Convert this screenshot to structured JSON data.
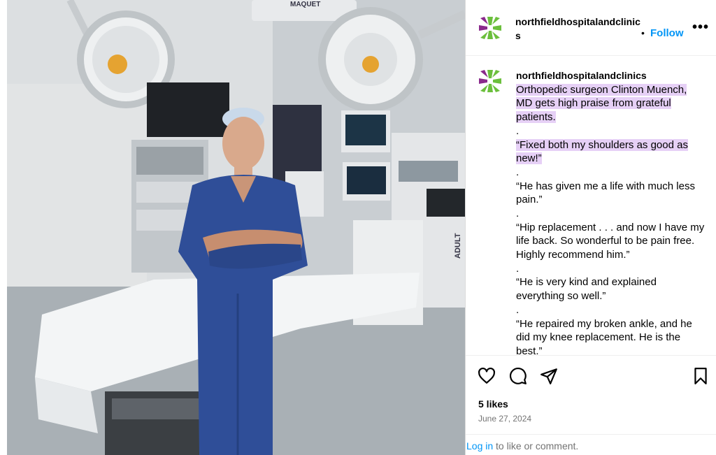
{
  "post": {
    "image_alt": "Surgeon in blue scrubs standing with arms crossed in an operating room",
    "equipment_text": "MAQUET",
    "equipment_side_text": "ADULT"
  },
  "header": {
    "username": "northfieldhospitalandclinics",
    "separator": "•",
    "follow_label": "Follow",
    "more_label": "•••"
  },
  "caption": {
    "username": "northfieldhospitalandclinics",
    "lines": [
      {
        "text": "Orthopedic surgeon Clinton Muench, MD gets high praise from grateful patients.",
        "highlight": true
      },
      {
        "text": ".",
        "highlight": false
      },
      {
        "text": "“Fixed both my shoulders as good as new!”",
        "highlight": true
      },
      {
        "text": ".",
        "highlight": false
      },
      {
        "text": "“He has given me a life with much less pain.”",
        "highlight": false
      },
      {
        "text": ".",
        "highlight": false
      },
      {
        "text": "“Hip replacement . . . and now I have my life back. So wonderful to be pain free. Highly recommend him.”",
        "highlight": false
      },
      {
        "text": ".",
        "highlight": false
      },
      {
        "text": "“He is very kind and explained everything so well.”",
        "highlight": false
      },
      {
        "text": ".",
        "highlight": false
      },
      {
        "text": "“He repaired my broken ankle, and he did my knee replacement. He is the best.”",
        "highlight": false
      }
    ]
  },
  "actions": {
    "icons": [
      "heart-icon",
      "comment-icon",
      "share-icon",
      "bookmark-icon"
    ]
  },
  "stats": {
    "likes": "5 likes",
    "date": "June 27, 2024"
  },
  "footer": {
    "login_link": "Log in",
    "login_rest": " to like or comment."
  },
  "colors": {
    "follow_blue": "#0095f6",
    "highlight": "#e6d0f6",
    "muted_text": "#737373",
    "scrubs_blue": "#2f4e98",
    "logo_green": "#6bbf3c",
    "logo_purple": "#8a2a8c"
  }
}
